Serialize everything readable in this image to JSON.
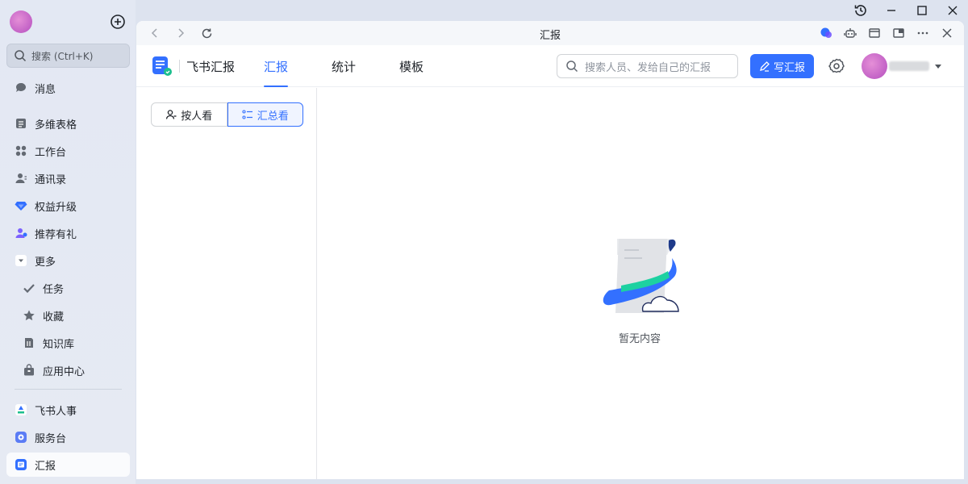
{
  "sidebar": {
    "search_placeholder": "搜索 (Ctrl+K)",
    "items": [
      {
        "label": "消息",
        "icon": "message-icon"
      },
      {
        "label": "多维表格",
        "icon": "table-icon"
      },
      {
        "label": "工作台",
        "icon": "workbench-icon"
      },
      {
        "label": "通讯录",
        "icon": "contacts-icon"
      },
      {
        "label": "权益升级",
        "icon": "diamond-icon"
      },
      {
        "label": "推荐有礼",
        "icon": "referral-icon"
      },
      {
        "label": "更多",
        "icon": "chevron-down-icon"
      },
      {
        "label": "任务",
        "icon": "check-icon"
      },
      {
        "label": "收藏",
        "icon": "star-icon"
      },
      {
        "label": "知识库",
        "icon": "wiki-icon"
      },
      {
        "label": "应用中心",
        "icon": "bag-icon"
      },
      {
        "label": "飞书人事",
        "icon": "hr-icon"
      },
      {
        "label": "服务台",
        "icon": "helpdesk-icon"
      },
      {
        "label": "汇报",
        "icon": "report-icon"
      }
    ]
  },
  "titlebar": {
    "title": "汇报"
  },
  "app": {
    "name": "飞书汇报",
    "tabs": [
      "汇报",
      "统计",
      "模板"
    ],
    "search_placeholder": "搜索人员、发给自己的汇报",
    "write_label": "写汇报"
  },
  "view": {
    "by_person": "按人看",
    "summary": "汇总看"
  },
  "empty": {
    "text": "暂无内容"
  },
  "colors": {
    "accent": "#3370ff"
  }
}
